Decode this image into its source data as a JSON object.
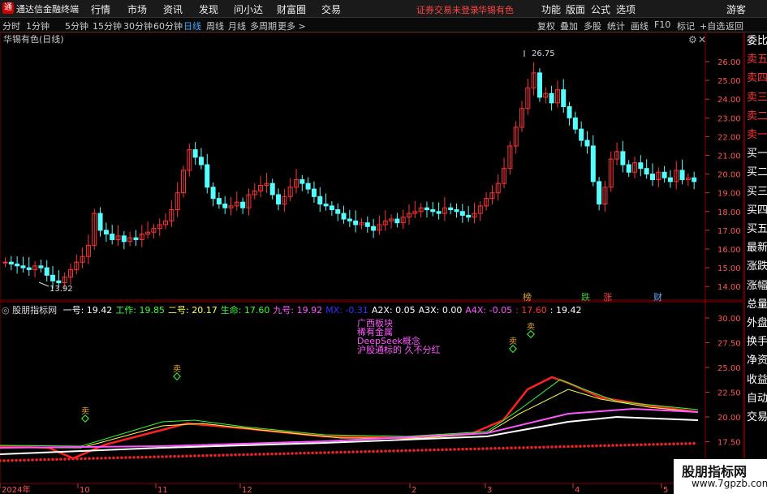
{
  "app": {
    "title": "通达信金融终端",
    "logo": "通"
  },
  "menu": [
    "行情",
    "市场",
    "资讯",
    "发现",
    "问小达",
    "财富圈",
    "交易"
  ],
  "status_warning": "证券交易未登录",
  "stock_name_top": "华锡有色",
  "top_right_menu": [
    "功能",
    "版面",
    "公式",
    "选项"
  ],
  "guest": "游客",
  "periods": [
    "分时",
    "1分钟",
    "5分钟",
    "15分钟",
    "30分钟",
    "60分钟",
    "日线",
    "周线",
    "月线",
    "多周期",
    "更多 >"
  ],
  "active_period": "日线",
  "tools": [
    "复权",
    "叠加",
    "多股",
    "统计",
    "画线",
    "F10",
    "标记",
    "+自选",
    "返回"
  ],
  "main_chart": {
    "title": "华锡有色(日线)",
    "high_label": "26.75",
    "low_label": "13.92",
    "y_ticks": [
      "26.00",
      "25.00",
      "24.00",
      "23.00",
      "22.00",
      "21.00",
      "20.00",
      "19.00",
      "18.00",
      "17.00",
      "16.00",
      "15.00",
      "14.00"
    ],
    "markers": [
      {
        "label": "榜",
        "color": "#e0a030"
      },
      {
        "label": "跌",
        "color": "#3c3"
      },
      {
        "label": "涨",
        "color": "#f44"
      },
      {
        "label": "财",
        "color": "#6af"
      }
    ]
  },
  "indicator": {
    "name": "股朋指标网",
    "values": [
      {
        "label": "一号: 19.42",
        "color": "#ffffff"
      },
      {
        "label": "工作: 19.85",
        "color": "#33ff33"
      },
      {
        "label": "二号: 20.17",
        "color": "#ffff55"
      },
      {
        "label": "生命: 17.60",
        "color": "#33ff33"
      },
      {
        "label": "九号: 19.92",
        "color": "#ff55ff"
      },
      {
        "label": "MX: -0.31",
        "color": "#3333ff"
      },
      {
        "label": "A2X: 0.05",
        "color": "#ffffff"
      },
      {
        "label": "A3X: 0.00",
        "color": "#ffffff"
      },
      {
        "label": "A4X: -0.05",
        "color": "#ff55ff"
      },
      {
        "label": ": 17.60",
        "color": "#ff3333"
      },
      {
        "label": ": 19.42",
        "color": "#ffffff"
      }
    ],
    "y_ticks": [
      "30.00",
      "27.50",
      "25.00",
      "22.50",
      "20.00",
      "17.50"
    ],
    "notes": [
      "广西板块",
      "稀有金属",
      "DeepSeek概念",
      "沪股通标的 久不分红"
    ],
    "sell_label": "卖"
  },
  "x_axis": [
    "2024年",
    "10",
    "11",
    "12",
    "2",
    "3",
    "4",
    "5"
  ],
  "right_panel": [
    "委比",
    "卖五",
    "卖四",
    "卖三",
    "卖二",
    "卖一",
    "买一",
    "买二",
    "买三",
    "买四",
    "买五",
    "最新",
    "涨跌",
    "涨幅",
    "总量",
    "外盘",
    "换手",
    "净资",
    "收益",
    "自动",
    "交易"
  ],
  "watermark": {
    "line1": "股朋指标网",
    "line2": "www.7gpzb.com"
  }
}
